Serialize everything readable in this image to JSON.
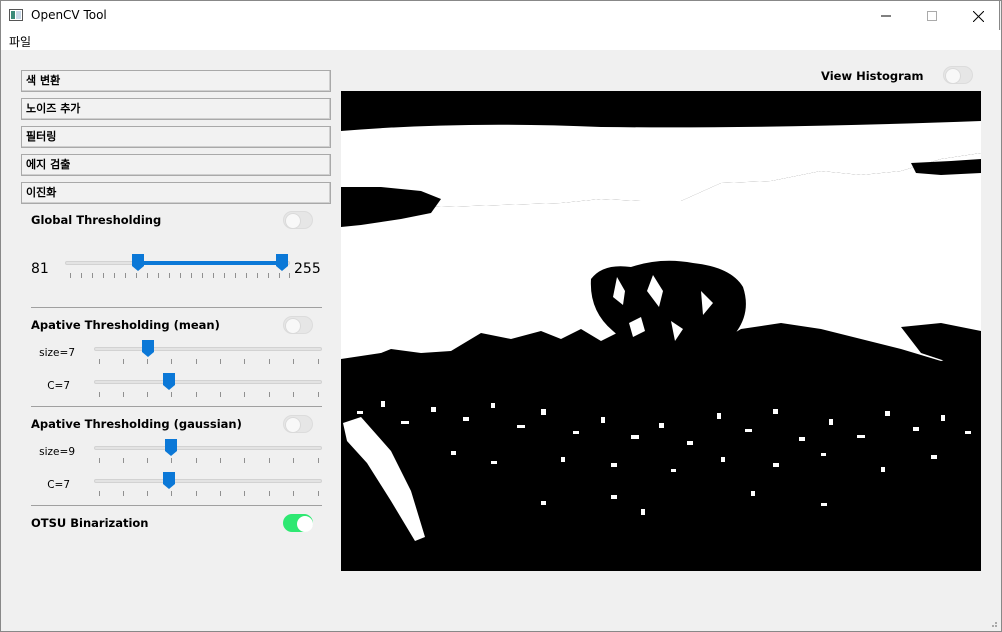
{
  "window": {
    "title": "OpenCV Tool",
    "icon": "opencv-app-icon"
  },
  "menu": {
    "items": [
      "파일"
    ]
  },
  "accordion": [
    "색 변환",
    "노이즈 추가",
    "필터링",
    "에지 검출",
    "이진화"
  ],
  "global_threshold": {
    "label": "Global Thresholding",
    "enabled": false,
    "low": 81,
    "high": 255,
    "min": 0,
    "max": 255
  },
  "adaptive_mean": {
    "label": "Apative Thresholding (mean)",
    "enabled": false,
    "size": {
      "label": "size=7",
      "value": 7
    },
    "c": {
      "label": "C=7",
      "value": 7
    }
  },
  "adaptive_gaussian": {
    "label": "Apative Thresholding (gaussian)",
    "enabled": false,
    "size": {
      "label": "size=9",
      "value": 9
    },
    "c": {
      "label": "C=7",
      "value": 7
    }
  },
  "otsu": {
    "label": "OTSU Binarization",
    "enabled": true
  },
  "histogram": {
    "label": "View Histogram",
    "enabled": false
  },
  "colors": {
    "accent": "#0b78d7",
    "toggle_on": "#2ee872"
  }
}
